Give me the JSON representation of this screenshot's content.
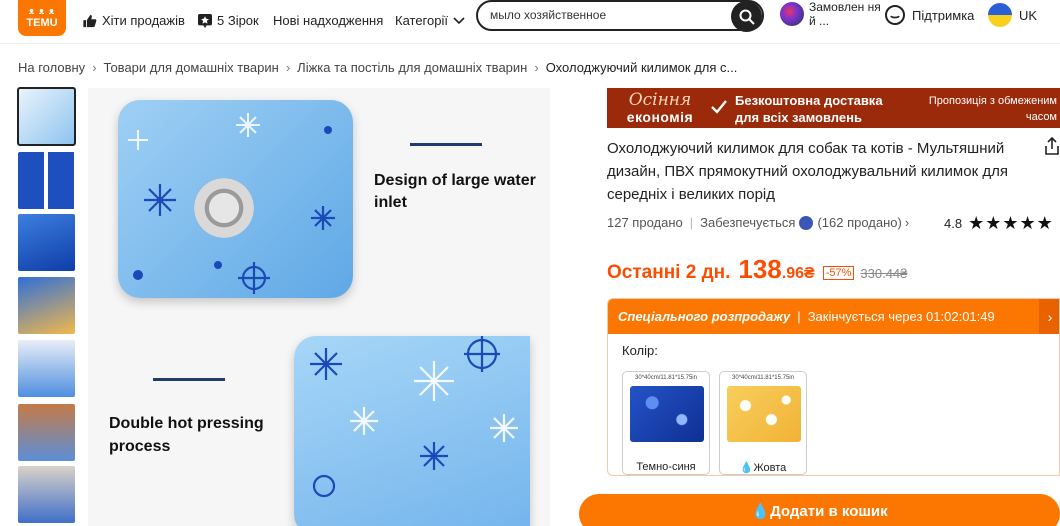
{
  "header": {
    "logo_top": "ᴥ ᴥ ᴥ",
    "logo_text": "TEMU",
    "nav": {
      "bestsellers": "Хіти продажів",
      "five_stars": "5 Зірок",
      "new_arrivals": "Нові надходження",
      "categories": "Категорії"
    },
    "search": {
      "value": "мыло хозяйственное"
    },
    "orders_label": "Замовлен ня й ...",
    "support_label": "Підтримка",
    "lang_label": "UK"
  },
  "breadcrumb": {
    "items": [
      "На головну",
      "Товари для домашніх тварин",
      "Ліжка та постіль для домашніх тварин",
      "Охолоджуючий килимок для с..."
    ]
  },
  "gallery": {
    "caption_1": "Design of large water inlet",
    "caption_2": "Double hot pressing process"
  },
  "banner": {
    "autumn_line1": "Осіння",
    "autumn_line2": "економія",
    "free_shipping": "Безкоштовна доставка для всіх замовлень",
    "limited_offer": "Пропозиція з обмеженим часом"
  },
  "product": {
    "title": "Охолоджуючий килимок для собак та котів - Мультяшний дизайн, ПВХ прямокутний охолоджувальний килимок для середніх і великих порід",
    "sold": "127 продано",
    "provided_by": "Забезпечується",
    "seller_sold": "(162 продано)",
    "rating": "4.8",
    "stars": "★★★★★"
  },
  "price": {
    "last_label": "Останні 2 дн.",
    "main": "138",
    "fraction": ".96₴",
    "discount": "-57%",
    "old": "330.44₴"
  },
  "sale": {
    "title": "Спеціального розпродажу",
    "ends_in": "Закінчується через 01:02:01:49",
    "color_label": "Колір:",
    "swatches": [
      {
        "dim": "30*40cm/11.81*15.75in",
        "name": "Темно-синя"
      },
      {
        "dim": "30*40cm/11.81*15.75in",
        "name": "💧Жовта"
      }
    ]
  },
  "cart": {
    "label": "💧Додати в кошик"
  },
  "colors": {
    "accent": "#fb7701",
    "price": "#fb4d01",
    "banner": "#9b2a0b"
  }
}
